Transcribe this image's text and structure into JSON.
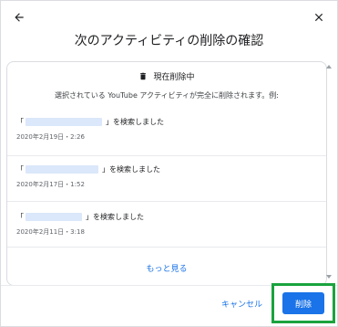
{
  "dialog": {
    "title": "次のアクティビティの削除の確認",
    "back_icon": "arrow-back-icon",
    "close_icon": "close-icon"
  },
  "status": {
    "icon": "trash-icon",
    "label": "現在削除中"
  },
  "description": "選択されている YouTube アクティビティが完全に削除されます。例:",
  "items": [
    {
      "open_bracket": "「",
      "suffix": "」を検索しました",
      "date": "2020年2月19日・2:26"
    },
    {
      "open_bracket": "「",
      "suffix": "」を検索しました",
      "date": "2020年2月17日・1:52"
    },
    {
      "open_bracket": "「",
      "suffix": "」を検索しました",
      "date": "2020年2月11日・3:18"
    }
  ],
  "more_link": "もっと見る",
  "footer": {
    "cancel_label": "キャンセル",
    "delete_label": "削除"
  },
  "colors": {
    "accent": "#1a73e8",
    "highlight": "#1aa33e",
    "redacted": "#dbe7fa"
  }
}
